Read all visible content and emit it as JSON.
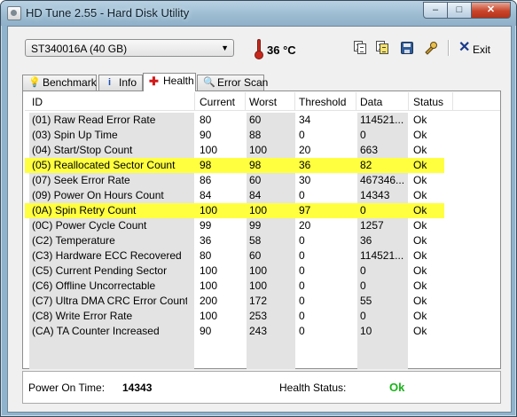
{
  "window": {
    "title": "HD Tune 2.55 - Hard Disk Utility",
    "min": "‒",
    "max": "□",
    "close": "✕"
  },
  "toolbar": {
    "drive": "ST340016A (40 GB)",
    "temperature": "36 °C",
    "exit_label": "Exit"
  },
  "tabs": [
    {
      "label": "Benchmark",
      "icon": "lightbulb-icon"
    },
    {
      "label": "Info",
      "icon": "info-icon"
    },
    {
      "label": "Health",
      "icon": "health-cross-icon",
      "active": true
    },
    {
      "label": "Error Scan",
      "icon": "magnifier-icon"
    }
  ],
  "table": {
    "headers": [
      "ID",
      "Current",
      "Worst",
      "Threshold",
      "Data",
      "Status"
    ],
    "rows": [
      {
        "id": "(01) Raw Read Error Rate",
        "current": "80",
        "worst": "60",
        "threshold": "34",
        "data": "114521...",
        "status": "Ok"
      },
      {
        "id": "(03) Spin Up Time",
        "current": "90",
        "worst": "88",
        "threshold": "0",
        "data": "0",
        "status": "Ok"
      },
      {
        "id": "(04) Start/Stop Count",
        "current": "100",
        "worst": "100",
        "threshold": "20",
        "data": "663",
        "status": "Ok"
      },
      {
        "id": "(05) Reallocated Sector Count",
        "current": "98",
        "worst": "98",
        "threshold": "36",
        "data": "82",
        "status": "Ok",
        "highlight": true
      },
      {
        "id": "(07) Seek Error Rate",
        "current": "86",
        "worst": "60",
        "threshold": "30",
        "data": "467346...",
        "status": "Ok"
      },
      {
        "id": "(09) Power On Hours Count",
        "current": "84",
        "worst": "84",
        "threshold": "0",
        "data": "14343",
        "status": "Ok"
      },
      {
        "id": "(0A) Spin Retry Count",
        "current": "100",
        "worst": "100",
        "threshold": "97",
        "data": "0",
        "status": "Ok",
        "highlight": true
      },
      {
        "id": "(0C) Power Cycle Count",
        "current": "99",
        "worst": "99",
        "threshold": "20",
        "data": "1257",
        "status": "Ok"
      },
      {
        "id": "(C2) Temperature",
        "current": "36",
        "worst": "58",
        "threshold": "0",
        "data": "36",
        "status": "Ok"
      },
      {
        "id": "(C3) Hardware ECC Recovered",
        "current": "80",
        "worst": "60",
        "threshold": "0",
        "data": "114521...",
        "status": "Ok"
      },
      {
        "id": "(C5) Current Pending Sector",
        "current": "100",
        "worst": "100",
        "threshold": "0",
        "data": "0",
        "status": "Ok"
      },
      {
        "id": "(C6) Offline Uncorrectable",
        "current": "100",
        "worst": "100",
        "threshold": "0",
        "data": "0",
        "status": "Ok"
      },
      {
        "id": "(C7) Ultra DMA CRC Error Count",
        "current": "200",
        "worst": "172",
        "threshold": "0",
        "data": "55",
        "status": "Ok"
      },
      {
        "id": "(C8) Write Error Rate",
        "current": "100",
        "worst": "253",
        "threshold": "0",
        "data": "0",
        "status": "Ok"
      },
      {
        "id": "(CA) TA Counter Increased",
        "current": "90",
        "worst": "243",
        "threshold": "0",
        "data": "10",
        "status": "Ok"
      }
    ]
  },
  "status": {
    "power_on_label": "Power On Time:",
    "power_on_value": "14343",
    "health_label": "Health Status:",
    "health_value": "Ok",
    "health_color": "#19b419"
  },
  "colors": {
    "highlight": "#ffff40",
    "chrome": "#9dbcd2"
  }
}
